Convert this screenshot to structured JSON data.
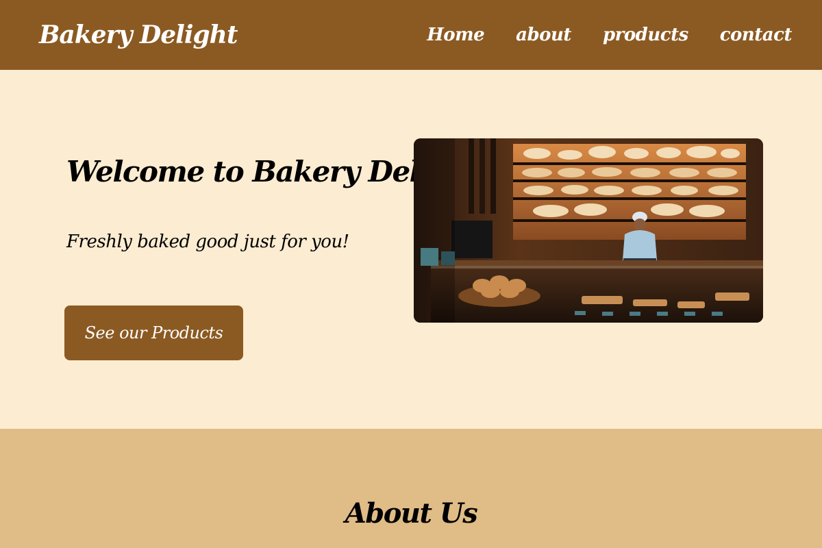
{
  "navbar": {
    "brand": "Bakery Delight",
    "links": [
      "Home",
      "about",
      "products",
      "contact"
    ]
  },
  "hero": {
    "title": "Welcome to Bakery Delight",
    "subtitle": "Freshly baked good just for you!",
    "cta_label": "See our Products"
  },
  "about": {
    "title": "About Us"
  },
  "colors": {
    "header_brown": "#8b5a22",
    "hero_cream": "#fcecd1",
    "about_tan": "#e0bc87",
    "button_brown": "#8b5a22",
    "text_dark": "#000000",
    "text_light": "#ffffff"
  }
}
